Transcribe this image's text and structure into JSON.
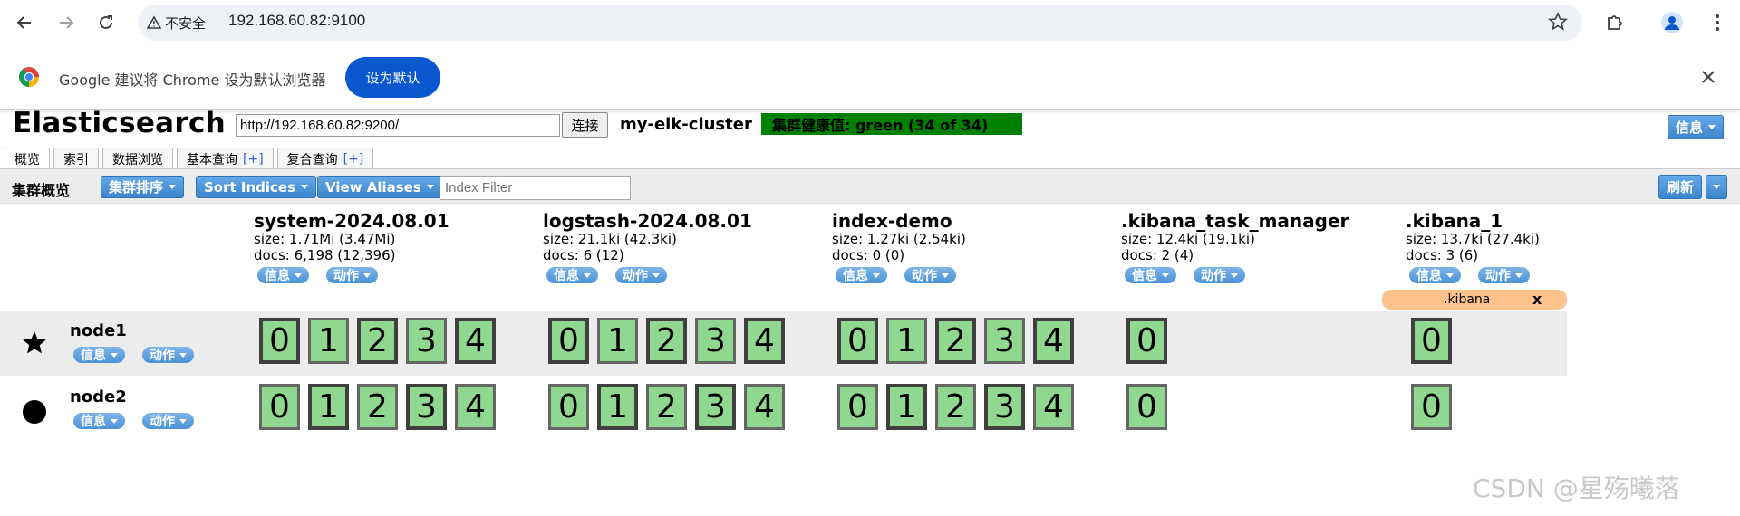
{
  "browser": {
    "insecure_label": "不安全",
    "url": "192.168.60.82:9100"
  },
  "infobar": {
    "message": "Google 建议将 Chrome 设为默认浏览器",
    "button": "设为默认"
  },
  "header": {
    "title": "Elasticsearch",
    "connect_url": "http://192.168.60.82:9200/",
    "connect_button": "连接",
    "cluster_name": "my-elk-cluster",
    "health": "集群健康值: green (34 of 34)",
    "health_color": "#008000",
    "info_button": "信息"
  },
  "tabs": [
    {
      "label": "概览",
      "plus": ""
    },
    {
      "label": "索引",
      "plus": ""
    },
    {
      "label": "数据浏览",
      "plus": ""
    },
    {
      "label": "基本查询",
      "plus": "[+]"
    },
    {
      "label": "复合查询",
      "plus": "[+]"
    }
  ],
  "toolbar": {
    "label": "集群概览",
    "sort_cluster": "集群排序",
    "sort_indices": "Sort Indices",
    "view_aliases": "View Aliases",
    "filter_placeholder": "Index Filter",
    "refresh": "刷新"
  },
  "indices": [
    {
      "name": "system-2024.08.01",
      "size": "size: 1.71Mi (3.47Mi)",
      "docs": "docs: 6,198 (12,396)",
      "shards": [
        "0",
        "1",
        "2",
        "3",
        "4"
      ]
    },
    {
      "name": "logstash-2024.08.01",
      "size": "size: 21.1ki (42.3ki)",
      "docs": "docs: 6 (12)",
      "shards": [
        "0",
        "1",
        "2",
        "3",
        "4"
      ]
    },
    {
      "name": "index-demo",
      "size": "size: 1.27ki (2.54ki)",
      "docs": "docs: 0 (0)",
      "shards": [
        "0",
        "1",
        "2",
        "3",
        "4"
      ]
    },
    {
      "name": ".kibana_task_manager",
      "size": "size: 12.4ki (19.1ki)",
      "docs": "docs: 2 (4)",
      "shards": [
        "0"
      ]
    },
    {
      "name": ".kibana_1",
      "size": "size: 13.7ki (27.4ki)",
      "docs": "docs: 3 (6)",
      "shards": [
        "0"
      ]
    }
  ],
  "index_buttons": {
    "info": "信息",
    "action": "动作"
  },
  "alias": {
    "name": ".kibana",
    "close": "x"
  },
  "nodes": [
    {
      "name": "node1",
      "icon": "star-icon",
      "info": "信息",
      "action": "动作"
    },
    {
      "name": "node2",
      "icon": "circle-icon",
      "info": "信息",
      "action": "动作"
    }
  ],
  "watermark": "CSDN @星殇曦落"
}
